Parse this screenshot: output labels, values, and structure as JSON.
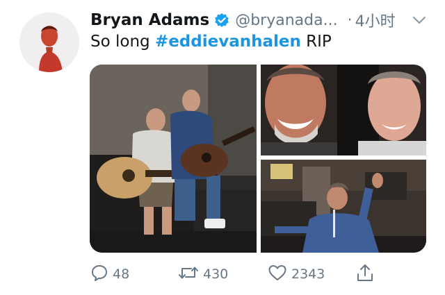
{
  "tweet": {
    "display_name": "Bryan Adams",
    "handle": "@bryanada...",
    "separator": "·",
    "time": "4小时",
    "text_prefix": "So long ",
    "hashtag": "#eddievanhalen",
    "text_suffix": " RIP",
    "verified": true
  },
  "media": [
    {
      "name": "photo-guitars"
    },
    {
      "name": "photo-selfie"
    },
    {
      "name": "photo-studio"
    }
  ],
  "actions": {
    "reply_count": "48",
    "retweet_count": "430",
    "like_count": "2343"
  },
  "icons": {
    "verified": "verified-badge-icon",
    "caret": "chevron-down-icon",
    "reply": "reply-icon",
    "retweet": "retweet-icon",
    "like": "heart-icon",
    "share": "share-icon"
  },
  "colors": {
    "name": "#14171a",
    "secondary": "#657786",
    "link": "#1b95e0",
    "verified": "#1da1f2"
  }
}
